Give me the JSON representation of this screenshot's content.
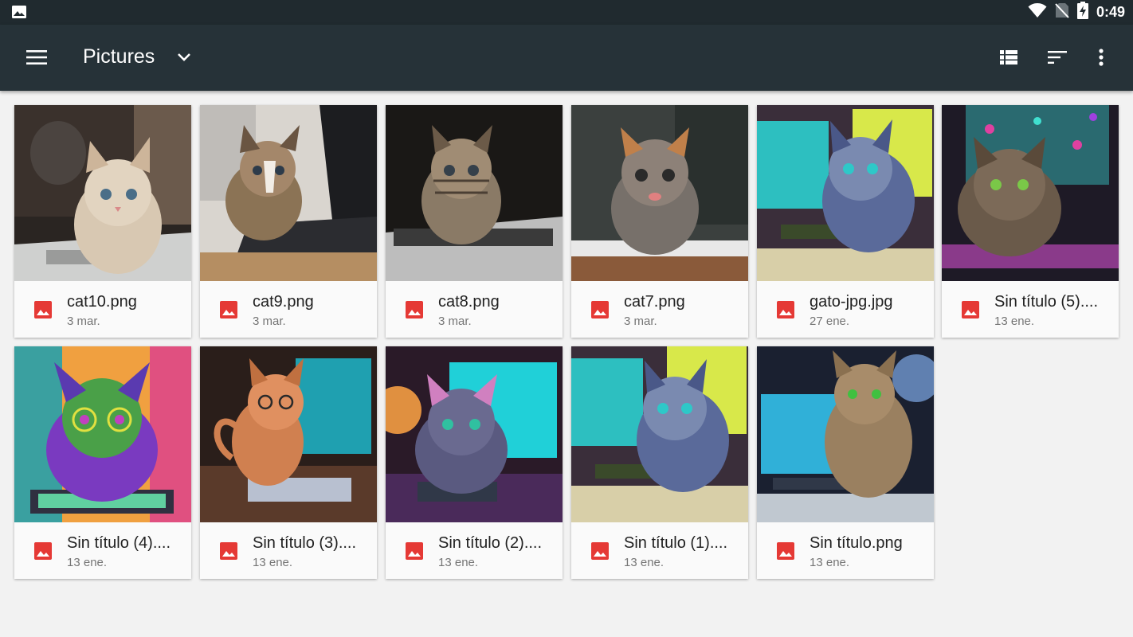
{
  "status_bar": {
    "time": "0:49",
    "icons": [
      "image-notification-icon",
      "wifi-icon",
      "no-sim-icon",
      "battery-charging-icon"
    ]
  },
  "toolbar": {
    "title": "Pictures",
    "icons": [
      "menu-icon",
      "chevron-down-icon",
      "list-view-icon",
      "sort-icon",
      "more-vert-icon"
    ]
  },
  "files": [
    {
      "name": "cat10.png",
      "date": "3 mar."
    },
    {
      "name": "cat9.png",
      "date": "3 mar."
    },
    {
      "name": "cat8.png",
      "date": "3 mar."
    },
    {
      "name": "cat7.png",
      "date": "3 mar."
    },
    {
      "name": "gato-jpg.jpg",
      "date": "27 ene."
    },
    {
      "name": "Sin título (5)....",
      "date": "13 ene."
    },
    {
      "name": "Sin título (4)....",
      "date": "13 ene."
    },
    {
      "name": "Sin título (3)....",
      "date": "13 ene."
    },
    {
      "name": "Sin título (2)....",
      "date": "13 ene."
    },
    {
      "name": "Sin título (1)....",
      "date": "13 ene."
    },
    {
      "name": "Sin título.png",
      "date": "13 ene."
    }
  ],
  "colors": {
    "status_bar": "#202a2f",
    "toolbar": "#263238",
    "background": "#f2f2f2",
    "image_icon": "#e53935"
  }
}
